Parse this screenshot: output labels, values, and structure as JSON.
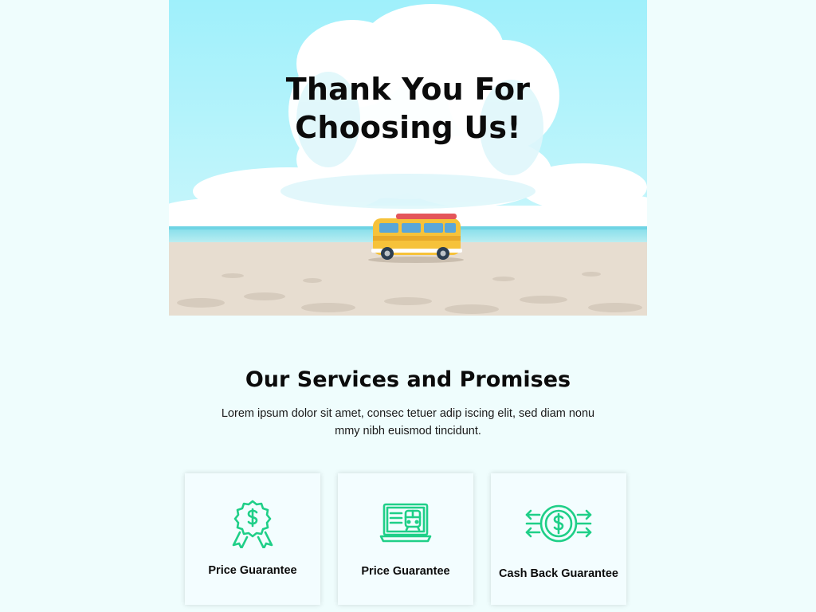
{
  "hero": {
    "title_line1": "Thank You For",
    "title_line2": "Choosing Us!"
  },
  "services": {
    "title": "Our Services and Promises",
    "description": "Lorem ipsum dolor sit amet, consec tetuer adip iscing elit, sed diam nonu mmy nibh euismod tincidunt."
  },
  "cards": [
    {
      "label": "Price Guarantee",
      "icon": "award-badge-dollar-icon"
    },
    {
      "label": "Price Guarantee",
      "icon": "laptop-train-ticket-icon"
    },
    {
      "label": "Cash Back Guarantee",
      "icon": "dollar-exchange-arrows-icon"
    }
  ],
  "colors": {
    "page_bg": "#effdfd",
    "icon_green": "#1fcf88",
    "sky": "#9eeefa",
    "sand": "#e8ddd0",
    "van_yellow": "#f6c23a"
  }
}
